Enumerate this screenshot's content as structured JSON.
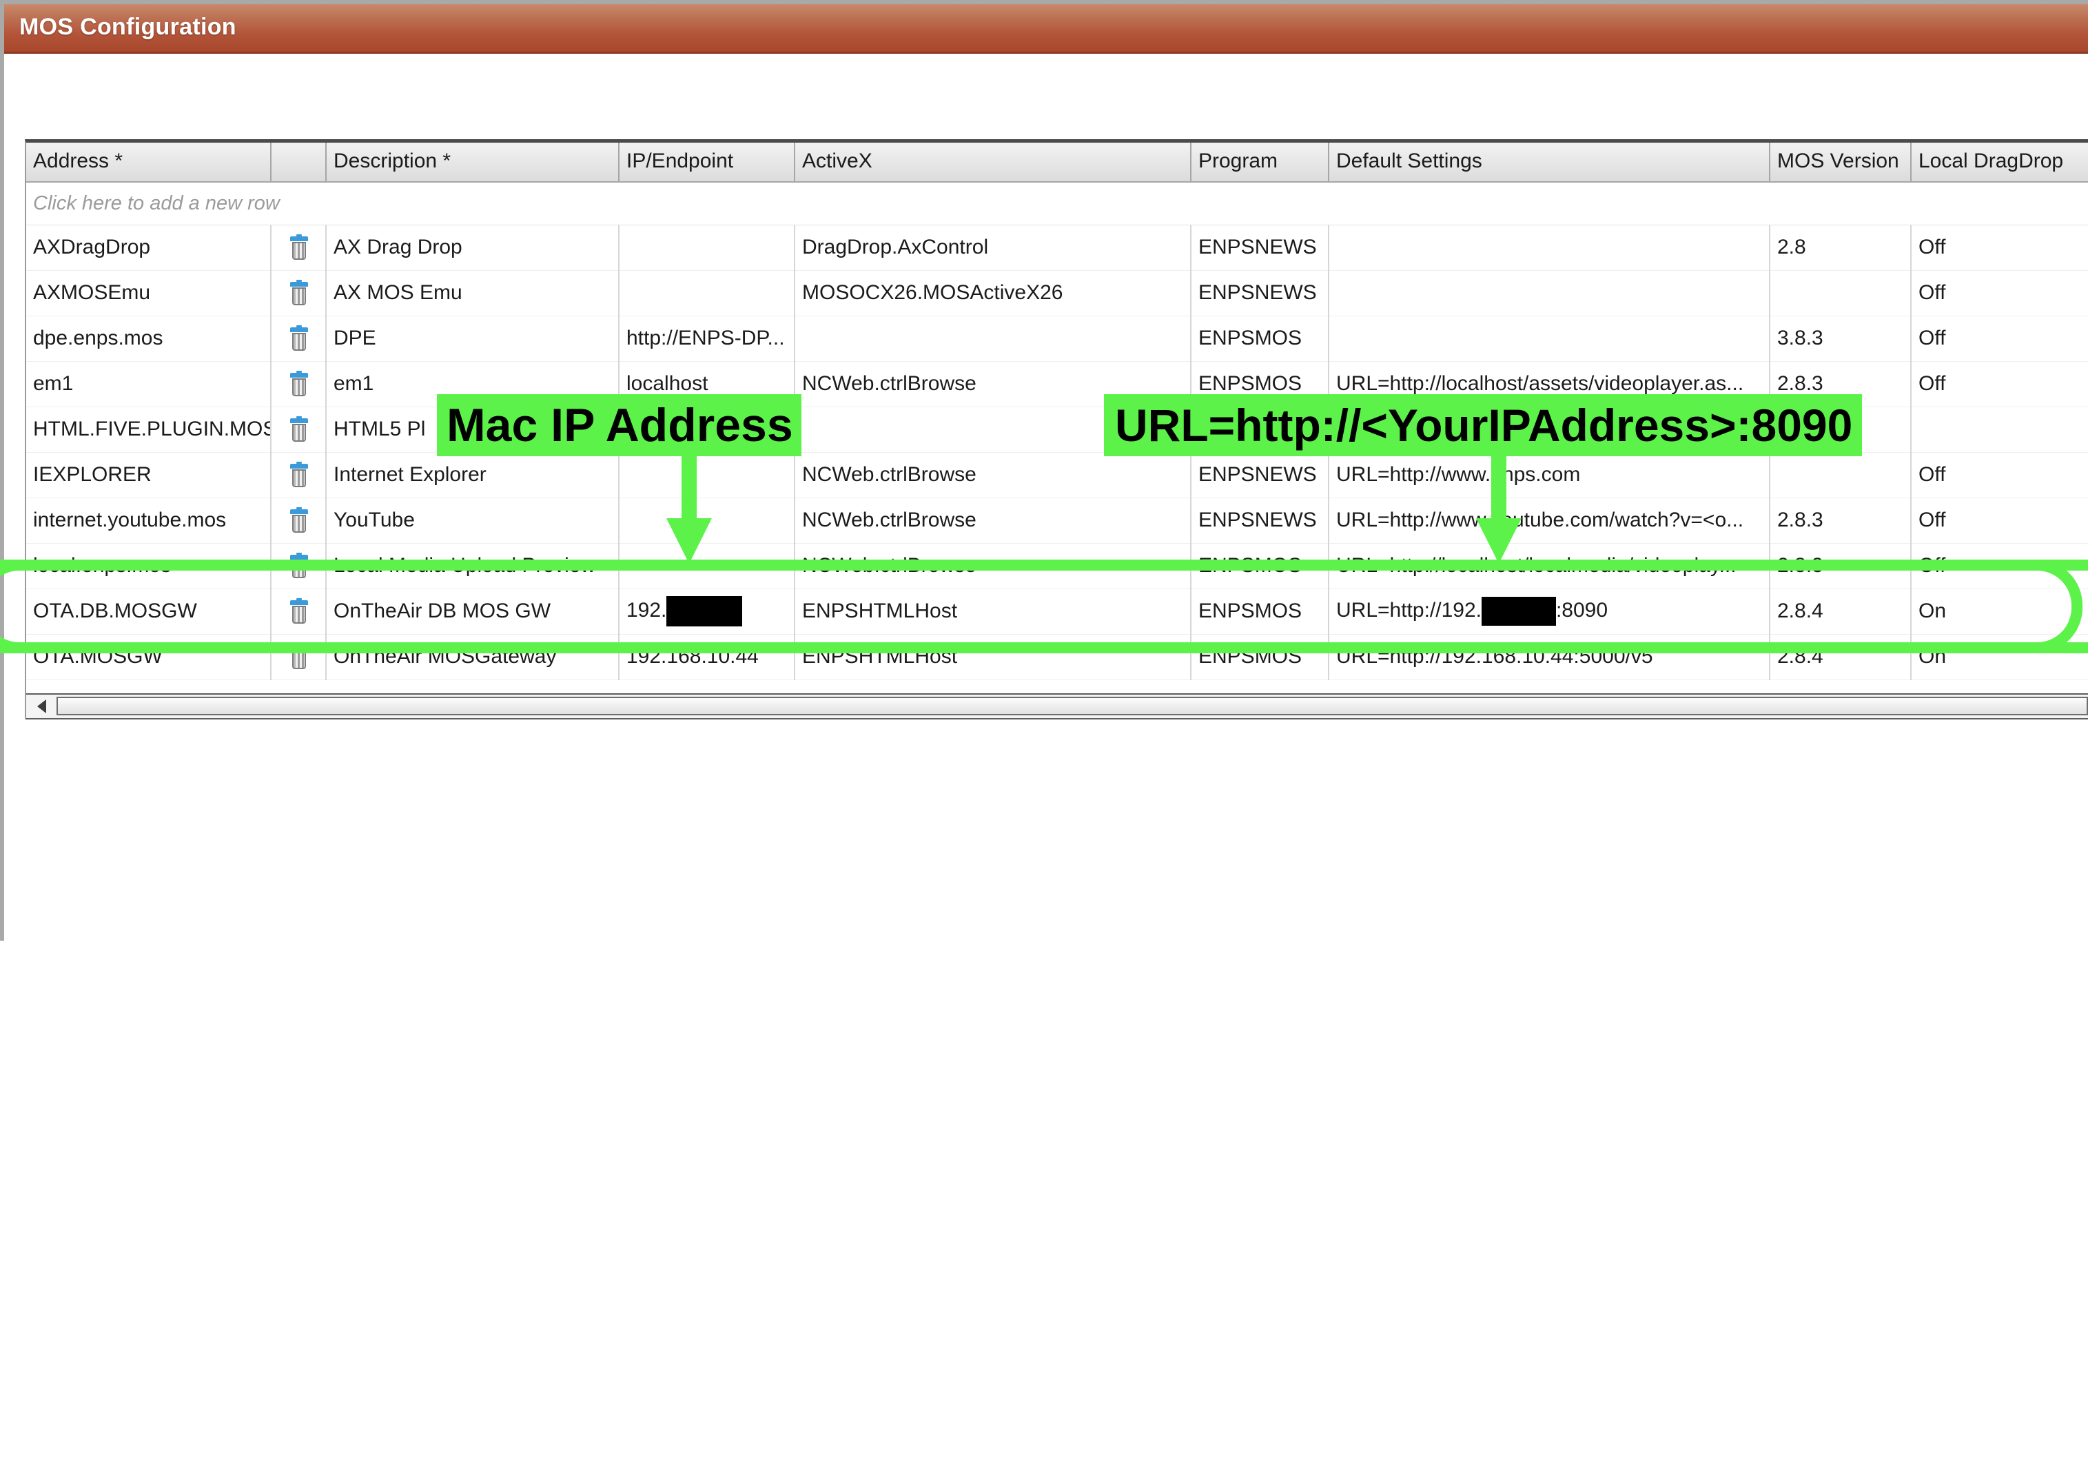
{
  "window": {
    "title": "MOS Configuration"
  },
  "grid": {
    "columns": [
      {
        "key": "address",
        "label": "Address *"
      },
      {
        "key": "delete",
        "label": ""
      },
      {
        "key": "description",
        "label": "Description *"
      },
      {
        "key": "ip",
        "label": "IP/Endpoint"
      },
      {
        "key": "activex",
        "label": "ActiveX"
      },
      {
        "key": "program",
        "label": "Program"
      },
      {
        "key": "settings",
        "label": "Default Settings"
      },
      {
        "key": "mos",
        "label": "MOS Version"
      },
      {
        "key": "dragdrop",
        "label": "Local DragDrop"
      }
    ],
    "new_row_hint": "Click here to add a new row",
    "delete_icon": "trash-icon",
    "rows": [
      {
        "address": "AXDragDrop",
        "description": "AX Drag Drop",
        "ip": "",
        "activex": "DragDrop.AxControl",
        "program": "ENPSNEWS",
        "settings": "",
        "mos": "2.8",
        "dragdrop": "Off",
        "highlighted": false
      },
      {
        "address": "AXMOSEmu",
        "description": "AX MOS Emu",
        "ip": "",
        "activex": "MOSOCX26.MOSActiveX26",
        "program": "ENPSNEWS",
        "settings": "",
        "mos": "",
        "dragdrop": "Off",
        "highlighted": false
      },
      {
        "address": "dpe.enps.mos",
        "description": "DPE",
        "ip": "http://ENPS-DP...",
        "activex": "",
        "program": "ENPSMOS",
        "settings": "",
        "mos": "3.8.3",
        "dragdrop": "Off",
        "highlighted": false
      },
      {
        "address": "em1",
        "description": "em1",
        "ip": "localhost",
        "activex": "NCWeb.ctrlBrowse",
        "program": "ENPSMOS",
        "settings": "URL=http://localhost/assets/videoplayer.as...",
        "mos": "2.8.3",
        "dragdrop": "Off",
        "highlighted": false
      },
      {
        "address": "HTML.FIVE.PLUGIN.MOS",
        "description": "HTML5 Pl",
        "ip": "",
        "activex": "",
        "program": "",
        "settings": "",
        "mos": "",
        "dragdrop": "",
        "highlighted": false
      },
      {
        "address": "IEXPLORER",
        "description": "Internet Explorer",
        "ip": "",
        "activex": "NCWeb.ctrlBrowse",
        "program": "ENPSNEWS",
        "settings": "URL=http://www.enps.com",
        "mos": "",
        "dragdrop": "Off",
        "highlighted": false
      },
      {
        "address": "internet.youtube.mos",
        "description": "YouTube",
        "ip": "",
        "activex": "NCWeb.ctrlBrowse",
        "program": "ENPSNEWS",
        "settings": "URL=http://www.youtube.com/watch?v=<o...",
        "mos": "2.8.3",
        "dragdrop": "Off",
        "highlighted": false
      },
      {
        "address": "local.enps.mos",
        "description": "Local Media Upload Preview",
        "ip": "",
        "activex": "NCWeb.ctrlBrowse",
        "program": "ENPSMOS",
        "settings": "URL=http://localhost/localmedia/videoplay...",
        "mos": "2.8.3",
        "dragdrop": "Off",
        "highlighted": false
      },
      {
        "address": "OTA.DB.MOSGW",
        "description": "OnTheAir DB MOS GW",
        "ip": "192.",
        "ip_redacted": true,
        "activex": "ENPSHTMLHost",
        "program": "ENPSMOS",
        "settings_prefix": "URL=http://192.",
        "settings_suffix": ":8090",
        "settings_redacted": true,
        "settings": "URL=http://192.[redacted]:8090",
        "mos": "2.8.4",
        "dragdrop": "On",
        "highlighted": true
      },
      {
        "address": "OTA.MOSGW",
        "description": "OnTheAir MOSGateway",
        "ip": "192.168.10.44",
        "activex": "ENPSHTMLHost",
        "program": "ENPSMOS",
        "settings": "URL=http://192.168.10.44:5000/v5",
        "mos": "2.8.4",
        "dragdrop": "On",
        "highlighted": false
      }
    ]
  },
  "scrollbar": {
    "left_arrow_icon": "triangle-left-icon"
  },
  "annotations": {
    "highlight_color": "#5CF24A",
    "left_callout": "Mac IP Address",
    "right_callout": "URL=http://<YourIPAddress>:8090",
    "left_arrow_icon": "arrow-down-icon",
    "right_arrow_icon": "arrow-down-icon",
    "target_row_address": "OTA.DB.MOSGW"
  }
}
